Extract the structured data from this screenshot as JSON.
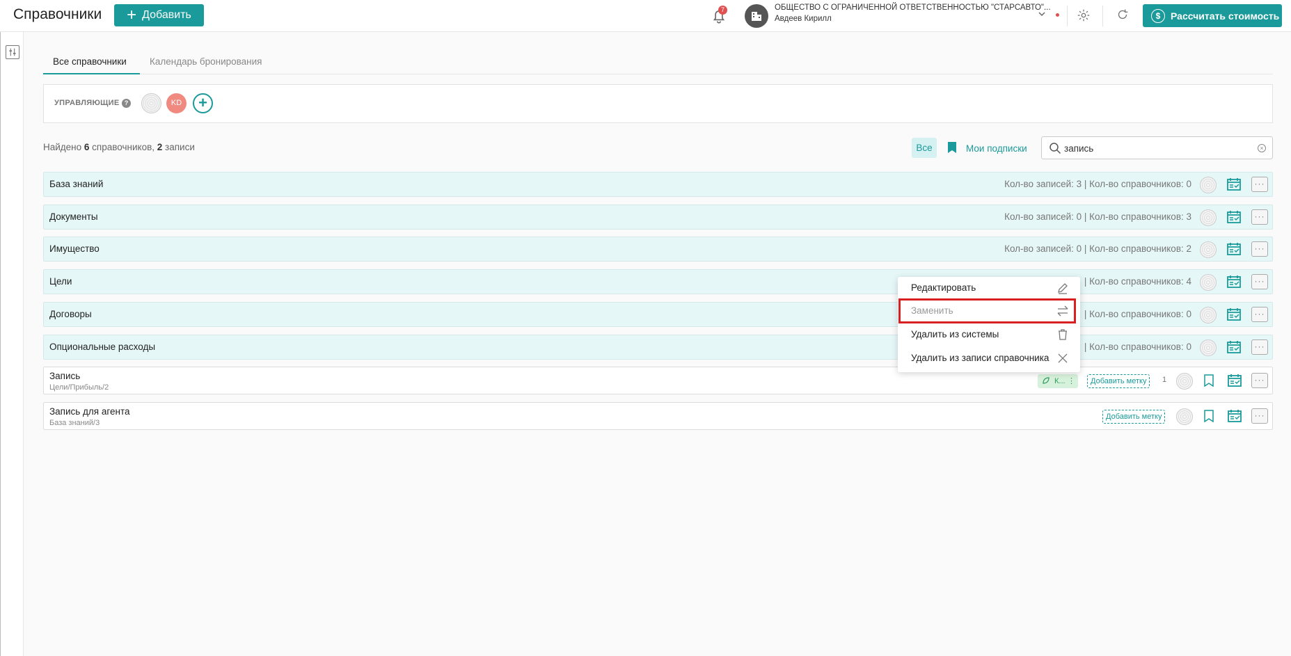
{
  "header": {
    "title": "Справочники",
    "add_label": "Добавить",
    "notifications_count": "7",
    "org_name": "ОБЩЕСТВО С ОГРАНИЧЕННОЙ ОТВЕТСТВЕННОСТЬЮ \"СТАРСАВТО\"...",
    "user_name": "Авдеев Кирилл",
    "calc_label": "Рассчитать стоимость"
  },
  "tabs": [
    {
      "label": "Все справочники",
      "active": true
    },
    {
      "label": "Календарь бронирования",
      "active": false
    }
  ],
  "managers": {
    "label": "УПРАВЛЯЮЩИЕ",
    "help": "?",
    "avatar_initials": "KD"
  },
  "filter": {
    "found_prefix": "Найдено ",
    "found_dirs": "6",
    "found_middle": " справочников, ",
    "found_records": "2",
    "found_suffix": " записи",
    "all_label": "Все",
    "subs_label": "Мои подписки",
    "search_value": "запись"
  },
  "directories": [
    {
      "name": "База знаний",
      "counts": "Кол-во записей: 3  |  Кол-во справочников: 0"
    },
    {
      "name": "Документы",
      "counts": "Кол-во записей: 0  |  Кол-во справочников: 3"
    },
    {
      "name": "Имущество",
      "counts": "Кол-во записей: 0  |  Кол-во справочников: 2"
    },
    {
      "name": "Цели",
      "counts": "|  Кол-во справочников: 4"
    },
    {
      "name": "Договоры",
      "counts": "|  Кол-во справочников: 0"
    },
    {
      "name": "Опциональные расходы",
      "counts": "|  Кол-во справочников: 0"
    }
  ],
  "records": [
    {
      "name": "Запись",
      "path": "Цели/Прибыль/2",
      "tag": "К...",
      "add_tag": "Добавить метку",
      "count": "1"
    },
    {
      "name": "Запись для агента",
      "path": "База знаний/3",
      "add_tag": "Добавить метку"
    }
  ],
  "context_menu": [
    {
      "label": "Редактировать",
      "icon": "pencil-icon"
    },
    {
      "label": "Заменить",
      "icon": "swap-icon",
      "disabled": true
    },
    {
      "label": "Удалить из системы",
      "icon": "trash-icon"
    },
    {
      "label": "Удалить из записи справочника",
      "icon": "close-icon"
    }
  ],
  "colors": {
    "accent": "#1a9a9a",
    "row_bg": "#e6f7f8",
    "highlight": "#d82020",
    "badge": "#e05050"
  }
}
